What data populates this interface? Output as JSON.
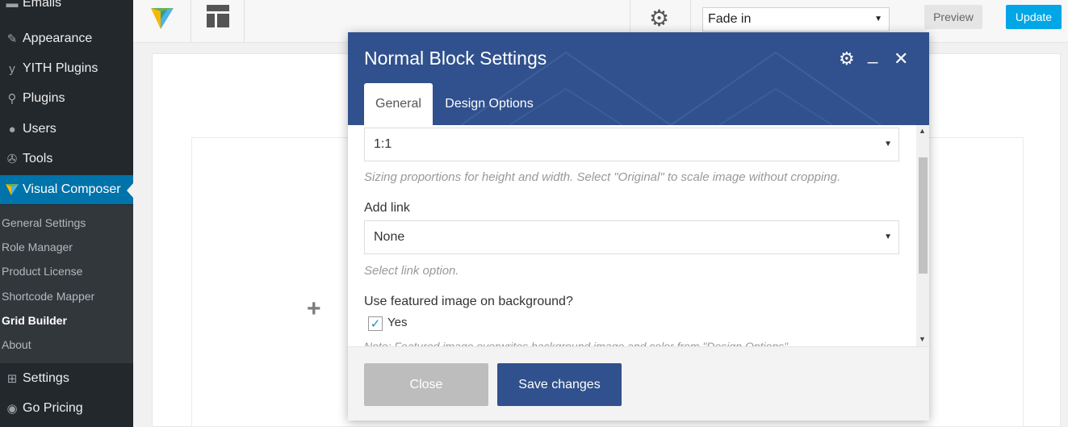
{
  "sidebar": {
    "items": [
      {
        "label": "Emails",
        "icon": "email-icon"
      },
      {
        "label": "Appearance",
        "icon": "paintbrush-icon"
      },
      {
        "label": "YITH Plugins",
        "icon": "yith-icon"
      },
      {
        "label": "Plugins",
        "icon": "plugin-icon"
      },
      {
        "label": "Users",
        "icon": "user-icon"
      },
      {
        "label": "Tools",
        "icon": "wrench-icon"
      },
      {
        "label": "Visual Composer",
        "icon": "vc-logo-icon"
      },
      {
        "label": "Settings",
        "icon": "settings-icon"
      },
      {
        "label": "Go Pricing",
        "icon": "go-pricing-icon"
      }
    ],
    "submenu": [
      {
        "label": "General Settings"
      },
      {
        "label": "Role Manager"
      },
      {
        "label": "Product License"
      },
      {
        "label": "Shortcode Mapper"
      },
      {
        "label": "Grid Builder"
      },
      {
        "label": "About"
      }
    ]
  },
  "toolbar": {
    "animation_value": "Fade in",
    "preview_label": "Preview",
    "update_label": "Update"
  },
  "modal": {
    "title": "Normal Block Settings",
    "tabs": [
      {
        "label": "General"
      },
      {
        "label": "Design Options"
      }
    ],
    "fields": {
      "ratio_value": "1:1",
      "ratio_help": "Sizing proportions for height and width. Select \"Original\" to scale image without cropping.",
      "link_label": "Add link",
      "link_value": "None",
      "link_help": "Select link option.",
      "featured_label": "Use featured image on background?",
      "featured_option": "Yes",
      "featured_note": "Note: Featured image overwrites background image and color from \"Design Options\"."
    },
    "footer": {
      "close_label": "Close",
      "save_label": "Save changes"
    }
  },
  "colors": {
    "sidebar_bg": "#23282d",
    "sidebar_active": "#0073aa",
    "modal_header": "#30518d",
    "update_button": "#00a6e6",
    "close_button": "#bdbdbd"
  }
}
